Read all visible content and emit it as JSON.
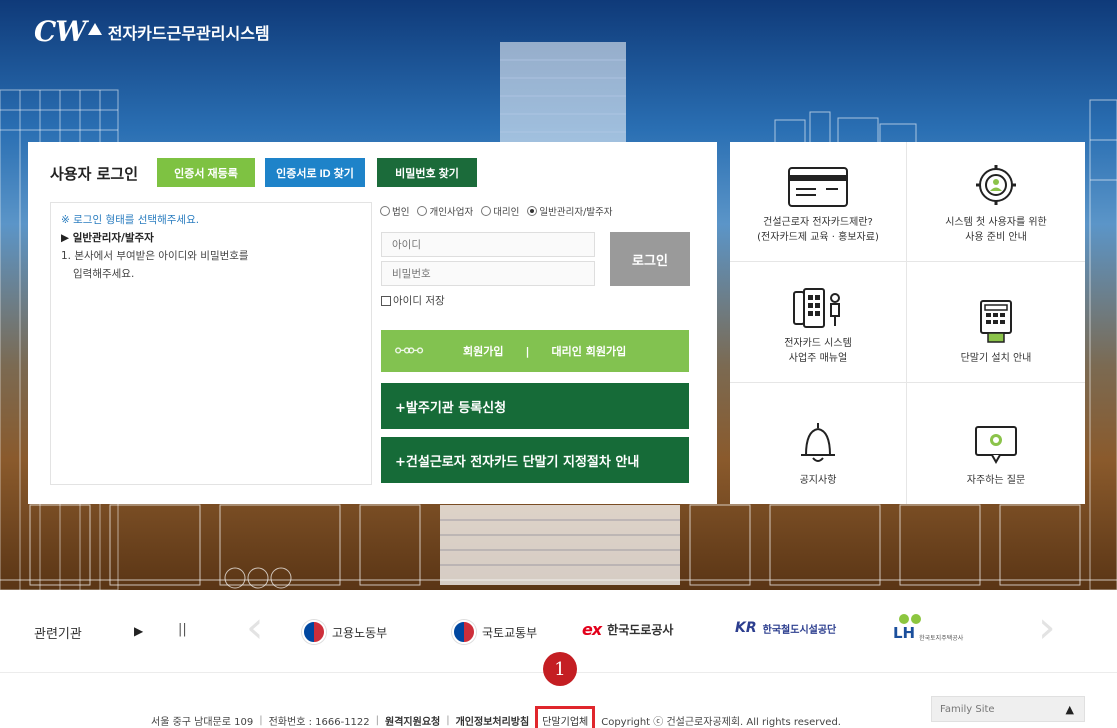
{
  "header": {
    "logo_mark": "CW",
    "title": "전자카드근무관리시스템"
  },
  "login": {
    "title": "사용자 로그인",
    "buttons": {
      "cert_reissue": "인증서 재등록",
      "find_id_by_cert": "인증서로 ID 찾기",
      "find_password": "비밀번호 찾기"
    },
    "guide": {
      "note": "※ 로그인 형태를 선택해주세요.",
      "heading": "▶ 일반관리자/발주자",
      "line1": "1. 본사에서 부여받은 아이디와 비밀번호를",
      "line2": "입력해주세요."
    },
    "login_types": [
      {
        "label": "법인",
        "selected": false
      },
      {
        "label": "개인사업자",
        "selected": false
      },
      {
        "label": "대리인",
        "selected": false
      },
      {
        "label": "일반관리자/발주자",
        "selected": true
      }
    ],
    "id_placeholder": "아이디",
    "pw_placeholder": "비밀번호",
    "login_button": "로그인",
    "save_id": "아이디 저장",
    "join": {
      "signup": "회원가입",
      "separator": "|",
      "agent_signup": "대리인 회원가입"
    },
    "ordering_agency_register": "+발주기관 등록신청",
    "terminal_guide": "+건설근로자 전자카드 단말기 지정절차 안내"
  },
  "quick_menu": [
    {
      "icon": "card-icon",
      "line1": "건설근로자 전자카드제란?",
      "line2": "(전자카드제 교육 · 홍보자료)"
    },
    {
      "icon": "user-gear-icon",
      "line1": "시스템 첫 사용자를 위한",
      "line2": "사용 준비 안내"
    },
    {
      "icon": "manual-icon",
      "line1": "전자카드 시스템",
      "line2": "사업주 매뉴얼"
    },
    {
      "icon": "terminal-icon",
      "line1": "단말기 설치 안내",
      "line2": ""
    },
    {
      "icon": "bell-icon",
      "line1": "공지사항",
      "line2": ""
    },
    {
      "icon": "faq-icon",
      "line1": "자주하는 질문",
      "line2": ""
    }
  ],
  "related": {
    "label": "관련기관",
    "play_icon": "▶",
    "pause_icon": "||",
    "agencies": [
      "고용노동부",
      "국토교통부",
      "한국도로공사",
      "한국철도시설공단",
      "LH"
    ],
    "ex_logo": "ex",
    "kr_logo": "KR",
    "lh_sub": "한국토지주택공사"
  },
  "footer": {
    "address": "서울 중구 남대문로 109",
    "phone": "전화번호 : 1666-1122",
    "remote_support": "원격지원요청",
    "privacy": "개인정보처리방침",
    "terminal_vendor": "단말기업체",
    "copyright": "Copyright ⓒ 건설근로자공제회. All rights reserved.",
    "family_site": "Family Site",
    "divider": "|"
  },
  "annotation": {
    "number": "1"
  },
  "colors": {
    "green_light": "#82c250",
    "green_dark": "#166b38",
    "blue": "#1e83c9",
    "highlight_red": "#e0262c"
  }
}
